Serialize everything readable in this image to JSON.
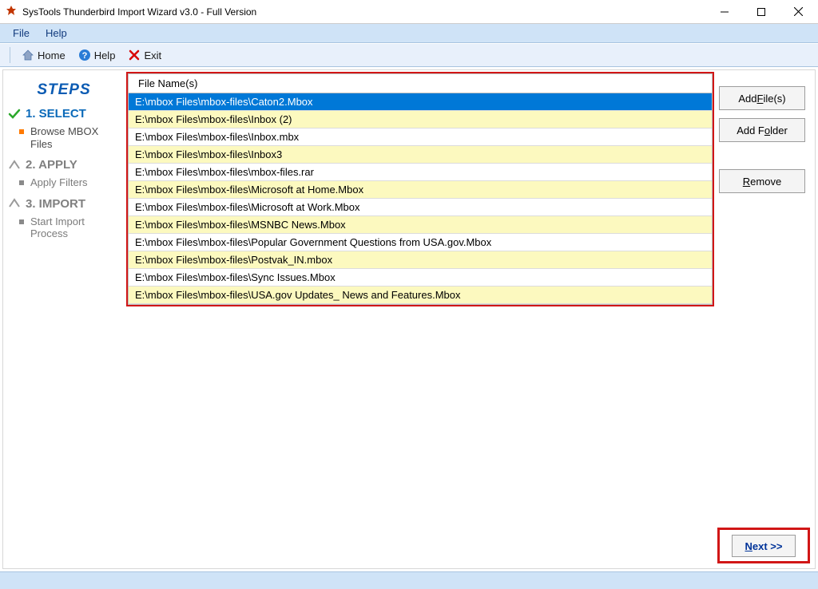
{
  "window": {
    "title": "SysTools Thunderbird Import Wizard v3.0 - Full Version"
  },
  "menubar": {
    "file": "File",
    "help": "Help"
  },
  "toolbar": {
    "home": "Home",
    "help": "Help",
    "exit": "Exit"
  },
  "sidebar": {
    "steps_title": "STEPS",
    "step1": {
      "label": "1. SELECT",
      "sub": "Browse MBOX Files"
    },
    "step2": {
      "label": "2. APPLY",
      "sub": "Apply Filters"
    },
    "step3": {
      "label": "3. IMPORT",
      "sub": "Start Import Process"
    }
  },
  "filelist": {
    "header": "File Name(s)",
    "rows": [
      "E:\\mbox Files\\mbox-files\\Caton2.Mbox",
      "E:\\mbox Files\\mbox-files\\Inbox (2)",
      "E:\\mbox Files\\mbox-files\\Inbox.mbx",
      "E:\\mbox Files\\mbox-files\\Inbox3",
      "E:\\mbox Files\\mbox-files\\mbox-files.rar",
      "E:\\mbox Files\\mbox-files\\Microsoft at Home.Mbox",
      "E:\\mbox Files\\mbox-files\\Microsoft at Work.Mbox",
      "E:\\mbox Files\\mbox-files\\MSNBC News.Mbox",
      "E:\\mbox Files\\mbox-files\\Popular Government Questions from USA.gov.Mbox",
      "E:\\mbox Files\\mbox-files\\Postvak_IN.mbox",
      "E:\\mbox Files\\mbox-files\\Sync Issues.Mbox",
      "E:\\mbox Files\\mbox-files\\USA.gov Updates_ News and Features.Mbox"
    ],
    "selected_index": 0
  },
  "buttons": {
    "add_files_pre": "Add ",
    "add_files_u": "F",
    "add_files_post": "ile(s)",
    "add_folder_pre": "Add F",
    "add_folder_u": "o",
    "add_folder_post": "lder",
    "remove_pre": "",
    "remove_u": "R",
    "remove_post": "emove",
    "next_u": "N",
    "next_post": "ext >>"
  }
}
